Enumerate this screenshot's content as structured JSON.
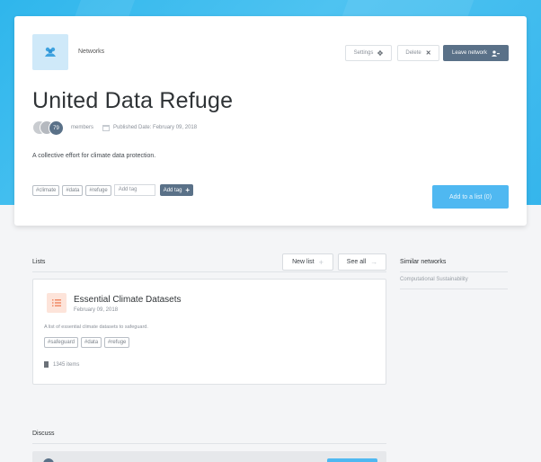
{
  "network": {
    "breadcrumb_label": "Networks",
    "title": "United Data Refuge",
    "member_count": "79",
    "members_label": "members",
    "published": "Published Date: February 09, 2018",
    "description": "A collective effort for climate data protection.",
    "tags": [
      "#climate",
      "#data",
      "#refuge"
    ],
    "add_tag_placeholder": "Add tag",
    "add_tag_button": "Add tag",
    "add_to_list_button": "Add to a list (0)"
  },
  "header_actions": {
    "settings_label": "Settings",
    "delete_label": "Delete",
    "leave_label": "Leave network"
  },
  "lists_section": {
    "heading": "Lists",
    "new_list_label": "New list",
    "see_all_label": "See all",
    "items": [
      {
        "title": "Essential Climate Datasets",
        "date": "February 09, 2018",
        "description": "A list of essential climate datasets to safeguard.",
        "tags": [
          "#safeguard",
          "#data",
          "#refuge"
        ],
        "count": "1345 items"
      }
    ]
  },
  "similar_section": {
    "heading": "Similar networks",
    "items": [
      "Computational Sustainability"
    ]
  },
  "discuss_section": {
    "heading": "Discuss"
  },
  "colors": {
    "hero": "#35b5ec",
    "primary_dark": "#5a7188",
    "accent_blue": "#4fb8f1",
    "list_badge": "#fde4da"
  },
  "icons": {
    "network": "users-icon",
    "settings": "gear-icon",
    "delete": "close-icon",
    "leave": "user-leave-icon",
    "calendar": "calendar-icon",
    "add": "plus-icon",
    "list": "list-icon",
    "document": "document-icon"
  }
}
